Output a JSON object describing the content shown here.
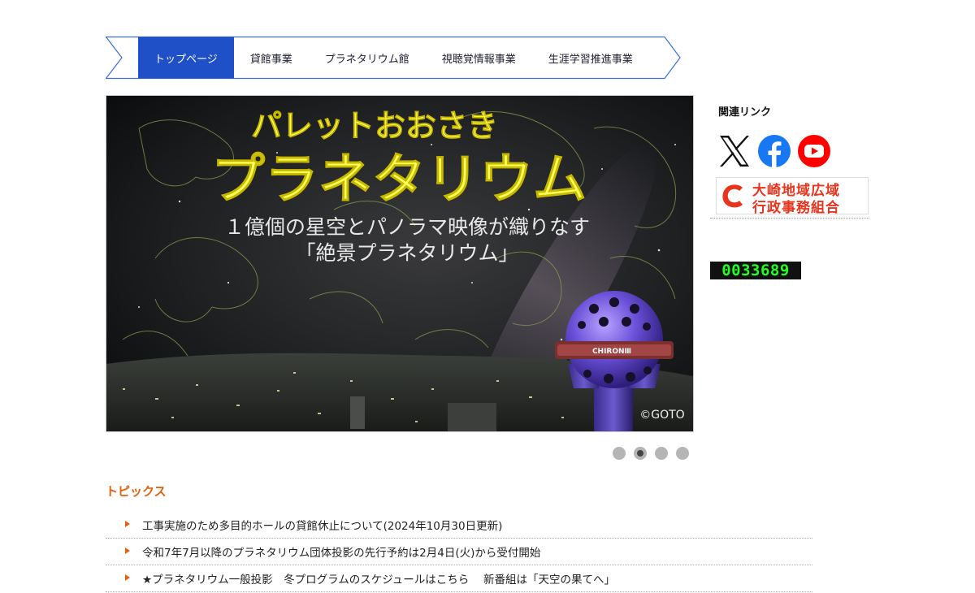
{
  "nav": {
    "items": [
      {
        "label": "トップページ",
        "active": true
      },
      {
        "label": "貸館事業"
      },
      {
        "label": "プラネタリウム館"
      },
      {
        "label": "視聴覚情報事業"
      },
      {
        "label": "生涯学習推進事業"
      }
    ],
    "colors": {
      "active": "#1f50c8",
      "border": "#3a6fd8"
    }
  },
  "slider": {
    "headline_small": "パレットおおさき",
    "headline_big": "プラネタリウム",
    "subline1": "１億個の星空とパノラマ映像が織りなす",
    "subline2": "「絶景プラネタリウム」",
    "projector_label": "CHIRONⅢ",
    "credit": "©GOTO",
    "dots_total": 4,
    "dot_active": 2
  },
  "sidebar": {
    "related_title": "関連リンク",
    "social": [
      {
        "icon": "x-icon"
      },
      {
        "icon": "facebook-icon"
      },
      {
        "icon": "youtube-icon"
      }
    ],
    "banner": {
      "line1": "大崎地域広域",
      "line2": "行政事務組合",
      "color": "#e8341c"
    },
    "counter": "0033689"
  },
  "topics": {
    "title": "トピックス",
    "items": [
      "工事実施のため多目的ホールの貸館休止について(2024年10月30日更新)",
      "令和7年7月以降のプラネタリウム団体投影の先行予約は2月4日(火)から受付開始",
      "★プラネタリウム一般投影　冬プログラムのスケジュールはこちら　 新番組は「天空の果てへ」"
    ],
    "accent": "#e2610e"
  }
}
